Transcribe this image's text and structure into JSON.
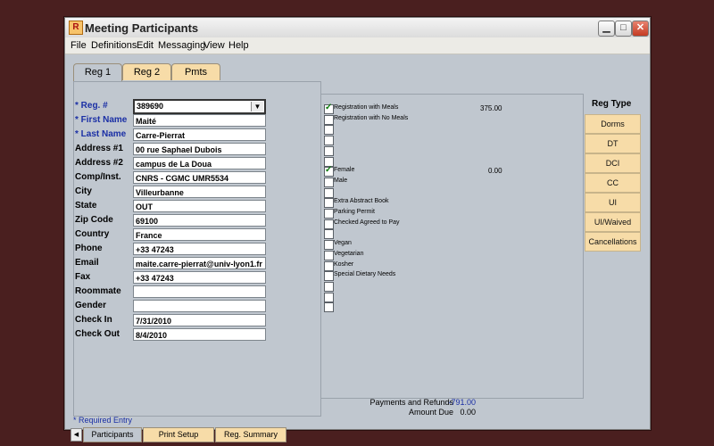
{
  "window": {
    "title": "Meeting Participants",
    "app_icon_letter": "R"
  },
  "menu": [
    "File",
    "Definitions",
    "Edit",
    "Messaging",
    "View",
    "Help"
  ],
  "tabs": [
    "Reg 1",
    "Reg 2",
    "Pmts"
  ],
  "fields": [
    {
      "label": "* Reg. #",
      "value": "389690",
      "required": true
    },
    {
      "label": "* First Name",
      "value": "Maité",
      "required": true
    },
    {
      "label": "* Last Name",
      "value": "Carre-Pierrat",
      "required": true
    },
    {
      "label": "Address #1",
      "value": "00 rue Saphael Dubois"
    },
    {
      "label": "Address #2",
      "value": "campus de La Doua"
    },
    {
      "label": "Comp/Inst.",
      "value": "CNRS - CGMC UMR5534"
    },
    {
      "label": "City",
      "value": "Villeurbanne"
    },
    {
      "label": "State",
      "value": "OUT"
    },
    {
      "label": "Zip Code",
      "value": "69100"
    },
    {
      "label": "Country",
      "value": "France"
    },
    {
      "label": "Phone",
      "value": "+33 47243"
    },
    {
      "label": "Email",
      "value": "maite.carre-pierrat@univ-lyon1.fr"
    },
    {
      "label": "Fax",
      "value": "+33 47243"
    },
    {
      "label": "Roommate",
      "value": ""
    },
    {
      "label": "Gender",
      "value": ""
    },
    {
      "label": "Check In",
      "value": "7/31/2010"
    },
    {
      "label": "Check Out",
      "value": "8/4/2010"
    }
  ],
  "options": [
    {
      "label": "Registration with Meals",
      "checked": true,
      "amount": "375.00"
    },
    {
      "label": "Registration with No Meals",
      "checked": false,
      "amount": ""
    },
    {
      "label": "",
      "checked": false,
      "amount": ""
    },
    {
      "label": "",
      "checked": false,
      "amount": ""
    },
    {
      "label": "",
      "checked": false,
      "amount": ""
    },
    {
      "label": "",
      "checked": false,
      "amount": ""
    },
    {
      "label": "Female",
      "checked": true,
      "amount": "0.00"
    },
    {
      "label": "Male",
      "checked": false,
      "amount": ""
    },
    {
      "label": "",
      "checked": false,
      "amount": ""
    },
    {
      "label": "Extra Abstract Book",
      "checked": false,
      "amount": ""
    },
    {
      "label": "Parking Permit",
      "checked": false,
      "amount": ""
    },
    {
      "label": "Checked Agreed to Pay",
      "checked": false,
      "amount": ""
    },
    {
      "label": "",
      "checked": false,
      "amount": ""
    },
    {
      "label": "Vegan",
      "checked": false,
      "amount": ""
    },
    {
      "label": "Vegetarian",
      "checked": false,
      "amount": ""
    },
    {
      "label": "Kosher",
      "checked": false,
      "amount": ""
    },
    {
      "label": "Special Dietary Needs",
      "checked": false,
      "amount": ""
    },
    {
      "label": "",
      "checked": false,
      "amount": ""
    },
    {
      "label": "",
      "checked": false,
      "amount": ""
    },
    {
      "label": "",
      "checked": false,
      "amount": ""
    }
  ],
  "reg_type": {
    "title": "Reg Type",
    "buttons": [
      "Dorms",
      "DT",
      "DCI",
      "CC",
      "UI",
      "UI/Waived",
      "Cancellations"
    ]
  },
  "payments": {
    "payments_label": "Payments and Refunds",
    "payments_value": "-791.00",
    "amount_due_label": "Amount Due",
    "amount_due_value": "0.00"
  },
  "required_note": "* Required Entry",
  "bottom_tabs": [
    "Participants",
    "Print Setup",
    "Reg. Summary"
  ],
  "colors": {
    "accent_tab": "#f7dca8",
    "required_label": "#1a2fa5",
    "check": "#0a7a0a"
  }
}
